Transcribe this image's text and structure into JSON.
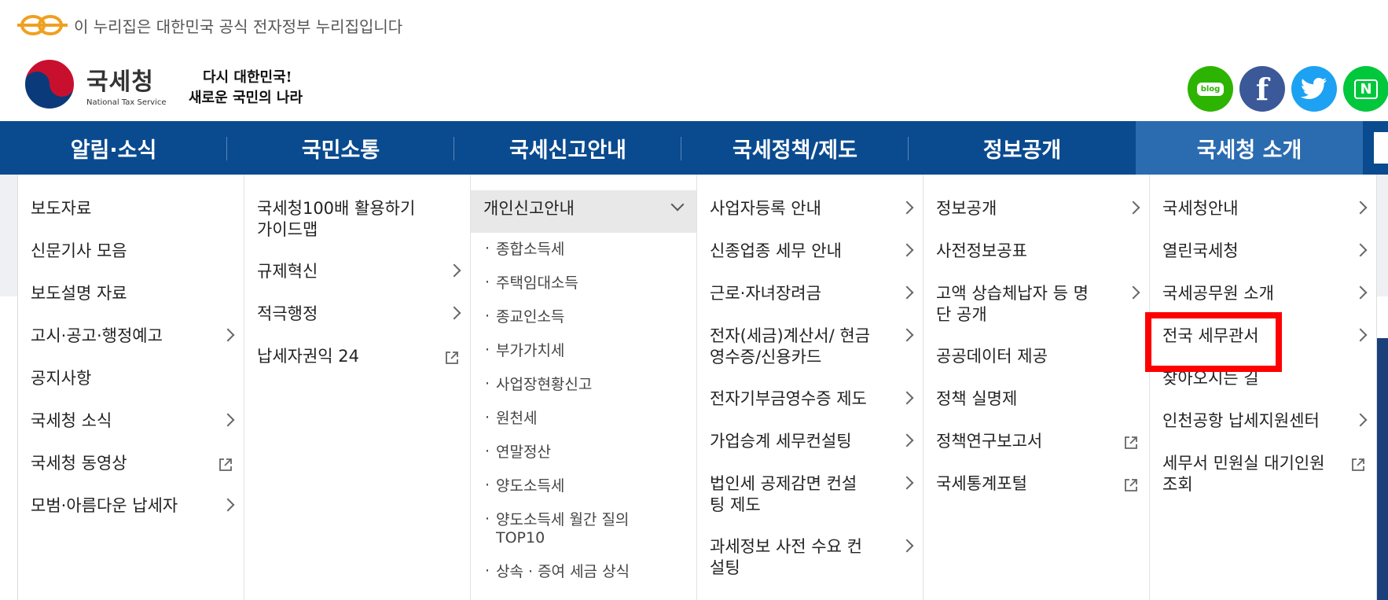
{
  "gov_banner": {
    "text": "이 누리집은 대한민국 공식 전자정부 누리집입니다"
  },
  "logo": {
    "name_ko": "국세청",
    "name_en": "National Tax Service"
  },
  "slogan": {
    "line1": "다시 대한민국!",
    "line2": "새로운 국민의 나라"
  },
  "sns": {
    "blog_label": "blog",
    "facebook_label": "f",
    "nb_label": "N"
  },
  "gnb": [
    {
      "label": "알림·소식"
    },
    {
      "label": "국민소통"
    },
    {
      "label": "국세신고안내"
    },
    {
      "label": "국세정책/제도"
    },
    {
      "label": "정보공개"
    },
    {
      "label": "국세청 소개"
    }
  ],
  "menu": {
    "col1": [
      {
        "label": "보도자료"
      },
      {
        "label": "신문기사 모음"
      },
      {
        "label": "보도설명 자료"
      },
      {
        "label": "고시·공고·행정예고"
      },
      {
        "label": "공지사항"
      },
      {
        "label": "국세청 소식"
      },
      {
        "label": "국세청 동영상"
      },
      {
        "label": "모범·아름다운 납세자"
      }
    ],
    "col2": [
      {
        "label": "국세청100배 활용하기 가이드맵"
      },
      {
        "label": "규제혁신"
      },
      {
        "label": "적극행정"
      },
      {
        "label": "납세자권익 24"
      }
    ],
    "col3": {
      "open_label": "개인신고안내",
      "subs": [
        "종합소득세",
        "주택임대소득",
        "종교인소득",
        "부가가치세",
        "사업장현황신고",
        "원천세",
        "연말정산",
        "양도소득세",
        "양도소득세 월간 질의 TOP10",
        "상속 · 증여 세금 상식"
      ]
    },
    "col4": [
      {
        "label": "사업자등록 안내"
      },
      {
        "label": "신종업종 세무 안내"
      },
      {
        "label": "근로·자녀장려금"
      },
      {
        "label": "전자(세금)계산서/ 현금영수증/신용카드"
      },
      {
        "label": "전자기부금영수증 제도"
      },
      {
        "label": "가업승계 세무컨설팅"
      },
      {
        "label": "법인세 공제감면 컨설팅 제도"
      },
      {
        "label": "과세정보 사전 수요 컨설팅"
      }
    ],
    "col5": [
      {
        "label": "정보공개"
      },
      {
        "label": "사전정보공표"
      },
      {
        "label": "고액 상습체납자 등 명단 공개"
      },
      {
        "label": "공공데이터 제공"
      },
      {
        "label": "정책 실명제"
      },
      {
        "label": "정책연구보고서"
      },
      {
        "label": "국세통계포털"
      }
    ],
    "col6": [
      {
        "label": "국세청안내"
      },
      {
        "label": "열린국세청"
      },
      {
        "label": "국세공무원 소개"
      },
      {
        "label": "전국 세무관서"
      },
      {
        "label": "찾아오시는 길"
      },
      {
        "label": "인천공항 납세지원센터"
      },
      {
        "label": "세무서 민원실 대기인원조회"
      }
    ]
  },
  "colors": {
    "nav_bg": "#0a4a8f",
    "nav_active": "#2b6cb0",
    "highlight": "#ff0000"
  }
}
